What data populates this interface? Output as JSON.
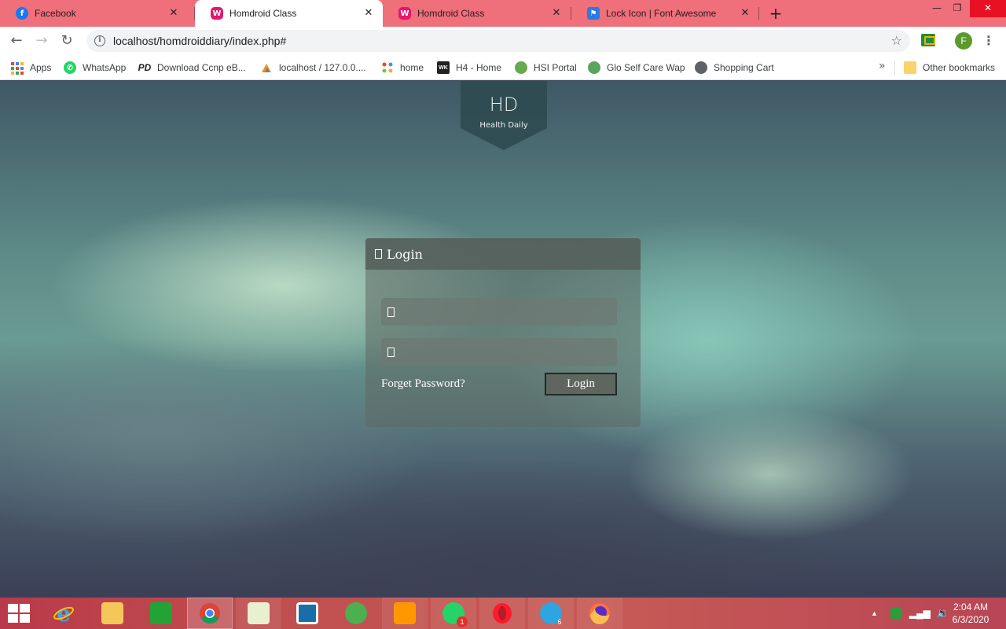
{
  "browser": {
    "tabs": [
      {
        "title": "Facebook",
        "favicon": "facebook-icon",
        "active": false
      },
      {
        "title": "Homdroid Class",
        "favicon": "wamp-icon",
        "active": true
      },
      {
        "title": "Homdroid Class",
        "favicon": "wamp-icon",
        "active": false
      },
      {
        "title": "Lock Icon | Font Awesome",
        "favicon": "font-awesome-flag-icon",
        "active": false
      }
    ],
    "url": "localhost/homdroiddiary/index.php#",
    "profile_initial": "F",
    "accent_color": "#ef6f7b"
  },
  "bookmarks": {
    "items": [
      {
        "label": "Apps",
        "icon": "apps-grid-icon"
      },
      {
        "label": "WhatsApp",
        "icon": "whatsapp-icon"
      },
      {
        "label": "Download Ccnp eB...",
        "icon": "pd-icon"
      },
      {
        "label": "localhost / 127.0.0....",
        "icon": "phpmyadmin-icon"
      },
      {
        "label": "home",
        "icon": "joomla-icon"
      },
      {
        "label": "H4 - Home",
        "icon": "wk-icon"
      },
      {
        "label": "HSI Portal",
        "icon": "hsi-icon"
      },
      {
        "label": "Glo Self Care Wap",
        "icon": "glo-icon"
      },
      {
        "label": "Shopping Cart",
        "icon": "globe-icon"
      }
    ],
    "more": "»",
    "other": "Other bookmarks"
  },
  "page": {
    "logo_text": "Health Daily",
    "login": {
      "heading": "Login",
      "username_placeholder": "",
      "password_placeholder": "",
      "forget_label": "Forget Password?",
      "submit_label": "Login"
    }
  },
  "taskbar": {
    "apps": [
      {
        "name": "internet-explorer-icon"
      },
      {
        "name": "file-explorer-icon"
      },
      {
        "name": "store-icon"
      },
      {
        "name": "chrome-icon"
      },
      {
        "name": "notepad-plus-plus-icon"
      },
      {
        "name": "brackets-icon"
      },
      {
        "name": "green-app-icon"
      },
      {
        "name": "sublime-text-icon"
      },
      {
        "name": "whatsapp-icon",
        "badge": "1"
      },
      {
        "name": "opera-icon"
      },
      {
        "name": "telegram-icon",
        "badge": "6"
      },
      {
        "name": "firefox-icon"
      }
    ],
    "time": "2:04 AM",
    "date": "6/3/2020"
  }
}
